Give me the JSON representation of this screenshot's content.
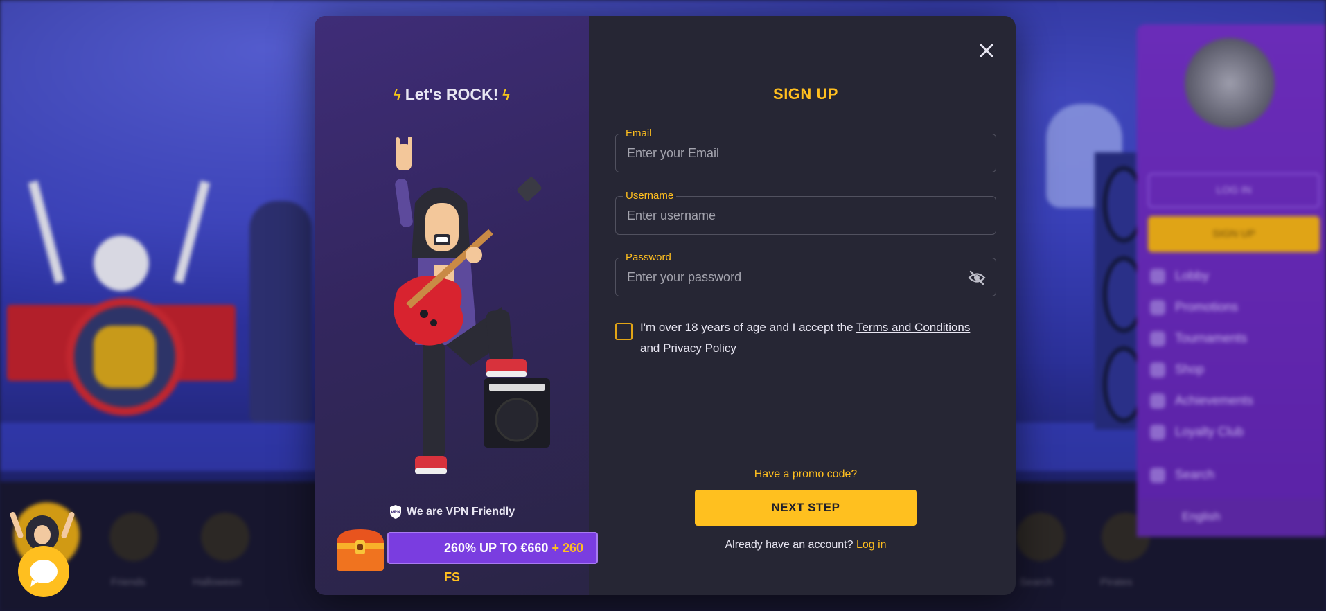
{
  "background": {
    "bottom_tiles": [
      "Friends",
      "Halloween",
      "Search",
      "Pirates"
    ],
    "sidebar": {
      "login_label": "LOG IN",
      "signup_label": "SIGN UP",
      "items": [
        "Lobby",
        "Promotions",
        "Tournaments",
        "Shop",
        "Achievements",
        "Loyalty Club",
        "Search"
      ],
      "language": "English"
    }
  },
  "modal": {
    "promo": {
      "headline": "Let's ROCK!",
      "vpn_text": "We are VPN Friendly",
      "bonus_main": "260% UP TO €660",
      "bonus_fs": "+ 260 FS"
    },
    "form": {
      "title": "SIGN UP",
      "email": {
        "label": "Email",
        "placeholder": "Enter your Email",
        "value": ""
      },
      "username": {
        "label": "Username",
        "placeholder": "Enter username",
        "value": ""
      },
      "password": {
        "label": "Password",
        "placeholder": "Enter your password",
        "value": ""
      },
      "terms": {
        "prefix": "I'm over 18 years of age and I accept the",
        "terms_link": "Terms and Conditions",
        "conjunction": "and",
        "privacy_link": "Privacy Policy",
        "checked": false
      },
      "promo_code_link": "Have a promo code?",
      "next_button": "NEXT STEP",
      "login_prompt": "Already have an account?",
      "login_link": "Log in"
    }
  },
  "colors": {
    "accent": "#ffbf1f",
    "modal_bg": "#262634",
    "promo_panel": "#3f2d78",
    "bonus_bar": "#7a3de0"
  }
}
